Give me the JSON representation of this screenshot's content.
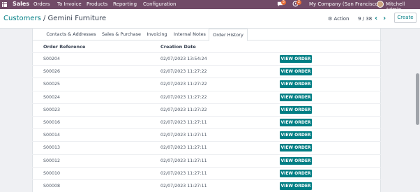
{
  "topbar": {
    "app_name": "Sales",
    "menu": [
      "Orders",
      "To Invoice",
      "Products",
      "Reporting",
      "Configuration"
    ],
    "messages_count": "5",
    "activity_count": "2",
    "company": "My Company (San Francisco)",
    "user": "Mitchell Admin",
    "brand_color": "#714b67"
  },
  "control_panel": {
    "breadcrumb_parent": "Customers",
    "separator": "/",
    "breadcrumb_current": "Gemini Furniture",
    "action_label": "Action",
    "pager": "9 / 38",
    "prev_icon": "chevron-left-icon",
    "next_icon": "chevron-right-icon",
    "create_label": "Create"
  },
  "tabs": [
    "Contacts & Addresses",
    "Sales & Purchase",
    "Invoicing",
    "Internal Notes",
    "Order History"
  ],
  "active_tab": "Order History",
  "table": {
    "headers": {
      "reference": "Order Reference",
      "date": "Creation Date"
    },
    "button_label": "VIEW ORDER",
    "accent_color": "#017e84",
    "rows": [
      {
        "ref": "S00204",
        "date": "02/07/2023 13:54:24"
      },
      {
        "ref": "S00026",
        "date": "02/07/2023 11:27:22"
      },
      {
        "ref": "S00025",
        "date": "02/07/2023 11:27:22"
      },
      {
        "ref": "S00024",
        "date": "02/07/2023 11:27:22"
      },
      {
        "ref": "S00023",
        "date": "02/07/2023 11:27:22"
      },
      {
        "ref": "S00016",
        "date": "02/07/2023 11:27:11"
      },
      {
        "ref": "S00014",
        "date": "02/07/2023 11:27:11"
      },
      {
        "ref": "S00013",
        "date": "02/07/2023 11:27:11"
      },
      {
        "ref": "S00012",
        "date": "02/07/2023 11:27:11"
      },
      {
        "ref": "S00010",
        "date": "02/07/2023 11:27:11"
      },
      {
        "ref": "S00008",
        "date": "02/07/2023 11:27:11"
      }
    ]
  }
}
